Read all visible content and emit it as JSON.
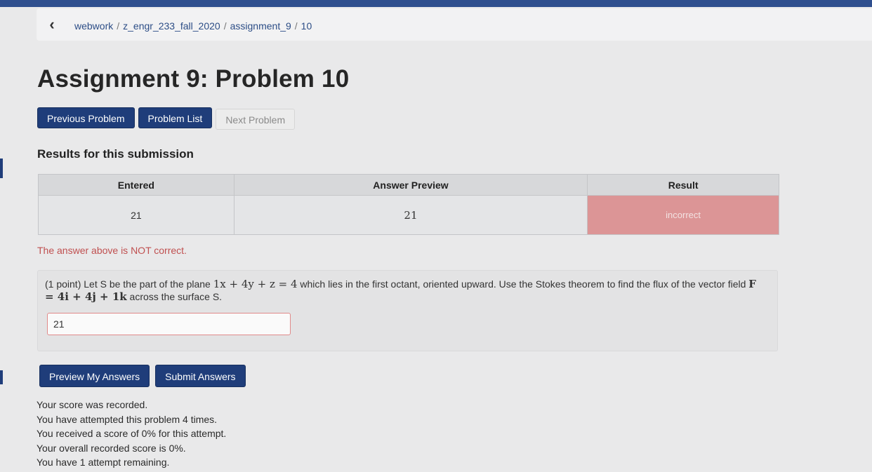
{
  "breadcrumb": {
    "back_icon": "chevron-left-icon",
    "parts": [
      "webwork",
      "z_engr_233_fall_2020",
      "assignment_9",
      "10"
    ]
  },
  "page_title": "Assignment 9: Problem 10",
  "nav": {
    "previous": "Previous Problem",
    "list": "Problem List",
    "next": "Next Problem"
  },
  "results": {
    "heading": "Results for this submission",
    "columns": [
      "Entered",
      "Answer Preview",
      "Result"
    ],
    "row": {
      "entered": "21",
      "preview": "21",
      "result": "incorrect"
    },
    "message": "The answer above is NOT correct."
  },
  "problem": {
    "lead": "(1 point) Let S be the part of the plane",
    "plane": "1x + 4y + z = 4",
    "mid": "which lies in the first octant, oriented upward. Use the Stokes theorem to find the flux of the vector field",
    "field": "F = 4i + 4j + 1k",
    "tail": "across the surface S.",
    "answer_value": "21"
  },
  "actions": {
    "preview": "Preview My Answers",
    "submit": "Submit Answers"
  },
  "status_messages": [
    "Your score was recorded.",
    "You have attempted this problem 4 times.",
    "You received a score of 0% for this attempt.",
    "Your overall recorded score is 0%.",
    "You have 1 attempt remaining."
  ],
  "colors": {
    "primary": "#1f3d7a",
    "incorrect_bg": "#dc9596",
    "error_text": "#c05050"
  }
}
